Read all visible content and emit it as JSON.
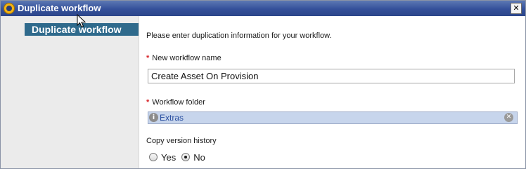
{
  "window": {
    "title": "Duplicate workflow",
    "close_label": "✕"
  },
  "sidebar": {
    "steps": [
      {
        "label": "Duplicate workflow",
        "active": true
      }
    ]
  },
  "form": {
    "intro": "Please enter duplication information for your workflow.",
    "name_field": {
      "required_mark": "*",
      "label": "New workflow name",
      "value": "Create Asset On Provision"
    },
    "folder_field": {
      "required_mark": "*",
      "label": "Workflow folder",
      "value": "Extras",
      "info_icon": "i",
      "clear_icon": "✕"
    },
    "copy_history": {
      "label": "Copy version history",
      "options": [
        {
          "label": "Yes",
          "selected": false
        },
        {
          "label": "No",
          "selected": true
        }
      ]
    }
  },
  "colors": {
    "titlebar": "#34509a",
    "step_active": "#2f6a8c",
    "folder_field_bg": "#c7d5ec",
    "required": "#d8262b"
  },
  "icons": {
    "app": "vco-orb-icon",
    "close": "close-icon",
    "info": "info-icon",
    "clear": "clear-icon"
  }
}
